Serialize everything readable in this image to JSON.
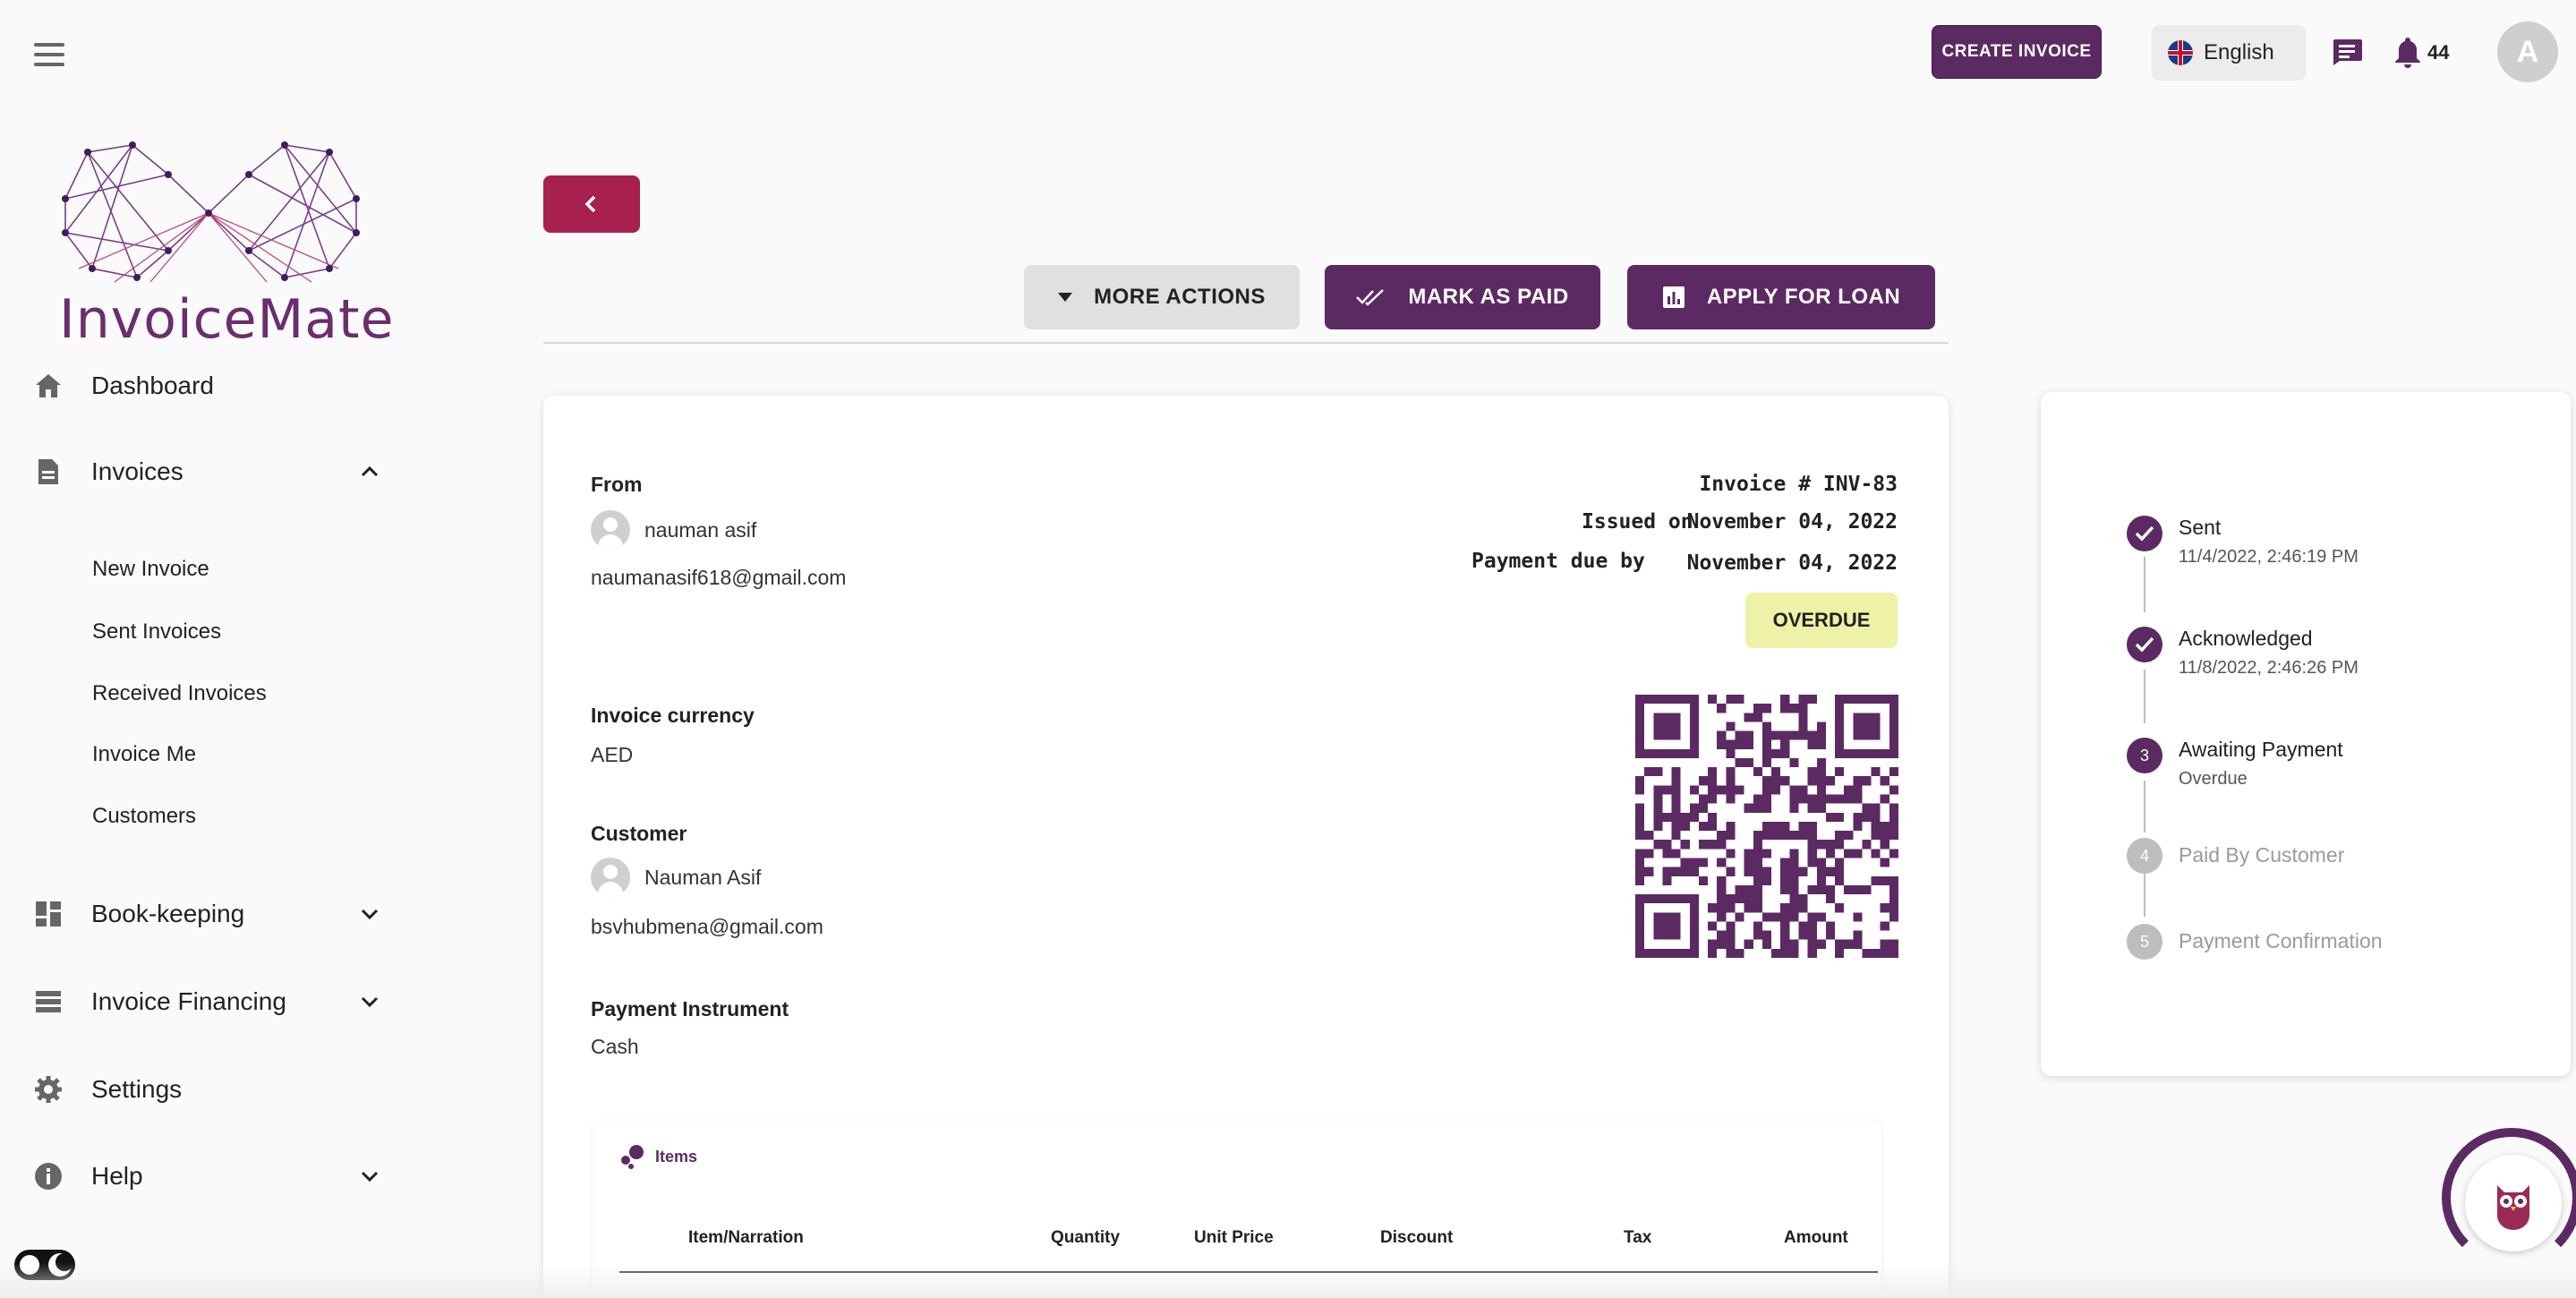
{
  "header": {
    "create_invoice_label": "CREATE INVOICE",
    "language": "English",
    "notification_count": "44",
    "avatar_initial": "A"
  },
  "brand": {
    "name": "InvoiceMate"
  },
  "sidebar": {
    "dashboard": "Dashboard",
    "invoices": "Invoices",
    "invoice_sub": [
      "New Invoice",
      "Sent Invoices",
      "Received Invoices",
      "Invoice Me",
      "Customers"
    ],
    "bookkeeping": "Book-keeping",
    "invoice_financing": "Invoice Financing",
    "settings": "Settings",
    "help": "Help"
  },
  "actions": {
    "more_actions": "MORE ACTIONS",
    "mark_as_paid": "MARK AS PAID",
    "apply_for_loan": "APPLY FOR LOAN"
  },
  "invoice": {
    "from_label": "From",
    "from_name": "nauman asif",
    "from_email": "naumanasif618@gmail.com",
    "invoice_number_label": "Invoice # INV-83",
    "issued_label": "Issued on",
    "issued_date": "November 04, 2022",
    "due_label": "Payment due by",
    "due_date": "November 04, 2022",
    "status": "OVERDUE",
    "currency_label": "Invoice currency",
    "currency": "AED",
    "customer_label": "Customer",
    "customer_name": "Nauman Asif",
    "customer_email": "bsvhubmena@gmail.com",
    "instrument_label": "Payment Instrument",
    "instrument": "Cash"
  },
  "items": {
    "title": "Items",
    "columns": [
      "Item/Narration",
      "Quantity",
      "Unit Price",
      "Discount",
      "Tax",
      "Amount"
    ]
  },
  "timeline": [
    {
      "title": "Sent",
      "detail": "11/4/2022, 2:46:19 PM",
      "state": "done"
    },
    {
      "title": "Acknowledged",
      "detail": "11/8/2022, 2:46:26 PM",
      "state": "done"
    },
    {
      "title": "Awaiting Payment",
      "detail": "Overdue",
      "state": "current",
      "num": "3"
    },
    {
      "title": "Paid By Customer",
      "detail": "",
      "state": "todo",
      "num": "4"
    },
    {
      "title": "Payment Confirmation",
      "detail": "",
      "state": "todo",
      "num": "5"
    }
  ],
  "colors": {
    "primary": "#5c2a63",
    "accent": "#a8204f",
    "overdue_bg": "#eef2a6"
  }
}
